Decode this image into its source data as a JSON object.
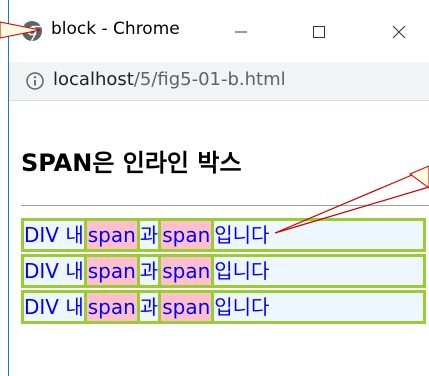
{
  "window": {
    "title": "block - Chrome",
    "url_host": "localhost",
    "url_path": "/5/fig5-01-b.html"
  },
  "page": {
    "heading": "SPAN은 인라인 박스"
  },
  "rows": [
    {
      "div_text": "DIV 내 ",
      "span1": "span",
      "mid": "과",
      "span2": "span",
      "end": "입니다"
    },
    {
      "div_text": "DIV 내 ",
      "span1": "span",
      "mid": "과",
      "span2": "span",
      "end": "입니다"
    },
    {
      "div_text": "DIV 내 ",
      "span1": "span",
      "mid": "과",
      "span2": "span",
      "end": "입니다"
    }
  ],
  "colors": {
    "row_border": "#9acd32",
    "row_bg": "#eef7ff",
    "span_bg": "#ffc0cb",
    "text": "#0000ff",
    "callout_line": "#cc0000",
    "callout_fill": "#fffbe0"
  }
}
